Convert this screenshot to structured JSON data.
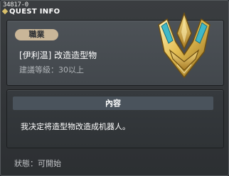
{
  "window": {
    "quest_id": "34817-0",
    "title": "QUEST INFO"
  },
  "quest": {
    "job_label": "職業",
    "name": "[伊利温] 改造造型物",
    "level_requirement": "建議等級：30以上",
    "medal_icon": "gold-crown-medal-icon"
  },
  "content": {
    "header": "內容",
    "description": "我决定将造型物改造成机器人。"
  },
  "status": {
    "text": "狀態：可開始"
  },
  "colors": {
    "accent_gold": "#d9c06b",
    "badge": "#c9b698",
    "medal_teal": "#3fb8c8"
  }
}
